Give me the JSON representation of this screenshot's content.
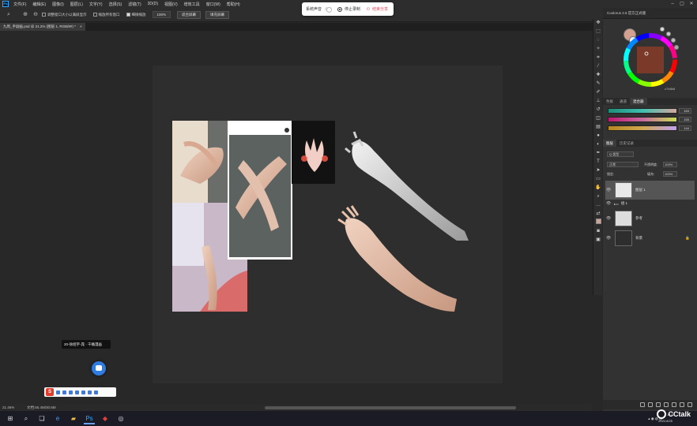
{
  "menubar": {
    "logo": "Ps",
    "items": [
      "文件(F)",
      "编辑(E)",
      "图像(I)",
      "图层(L)",
      "文字(Y)",
      "选择(S)",
      "滤镜(T)",
      "3D(D)",
      "视图(V)",
      "增效工具",
      "窗口(W)",
      "帮助(H)"
    ]
  },
  "options": {
    "resize_windows": "调整窗口大小以满屏显示",
    "zoom_all": "缩放所有窗口",
    "scrubby_zoom": "细微缩放",
    "zoom_value": "100%",
    "fit_screen": "适合屏幕",
    "fill_screen": "填充屏幕"
  },
  "recorder": {
    "system_sound": "系统声音",
    "stop_recording": "停止录制",
    "end_share": "结束分享"
  },
  "document_tab": {
    "title": "九周_手副画.psd @ 21.2% (图层 1, RGB/8#) *",
    "close": "×"
  },
  "status": {
    "zoom": "21.46%",
    "doc_size": "文档:65.4M/30.6M"
  },
  "color_panel": {
    "title": "Coolorus 2.6 官方正式版",
    "color_id": "c7b8b8",
    "tabs": [
      "色板",
      "通道",
      "混合器"
    ],
    "sliders": [
      {
        "value": "183"
      },
      {
        "value": "155"
      },
      {
        "value": "144"
      }
    ]
  },
  "layers_panel": {
    "tabs": [
      "图层",
      "历史记录"
    ],
    "kind_filter": "Q 类型",
    "blend_mode": "正常",
    "opacity_label": "不透明度:",
    "opacity_value": "100%",
    "lock_label": "锁定:",
    "fill_label": "填充:",
    "fill_value": "100%",
    "layers": [
      {
        "name": "图层 1"
      },
      {
        "name": "组 1"
      },
      {
        "name": "参考"
      },
      {
        "name": "背景"
      }
    ]
  },
  "tooltip": "20-徐绍宇-晁 · 干桶漫画",
  "taskbar": {
    "time": "14:33",
    "date": "2021/4/25",
    "brand": "CCtalk"
  },
  "colors": {
    "accent_blue": "#2f7de1",
    "record_red": "#e24a5c",
    "foreground": "#d4a090"
  }
}
